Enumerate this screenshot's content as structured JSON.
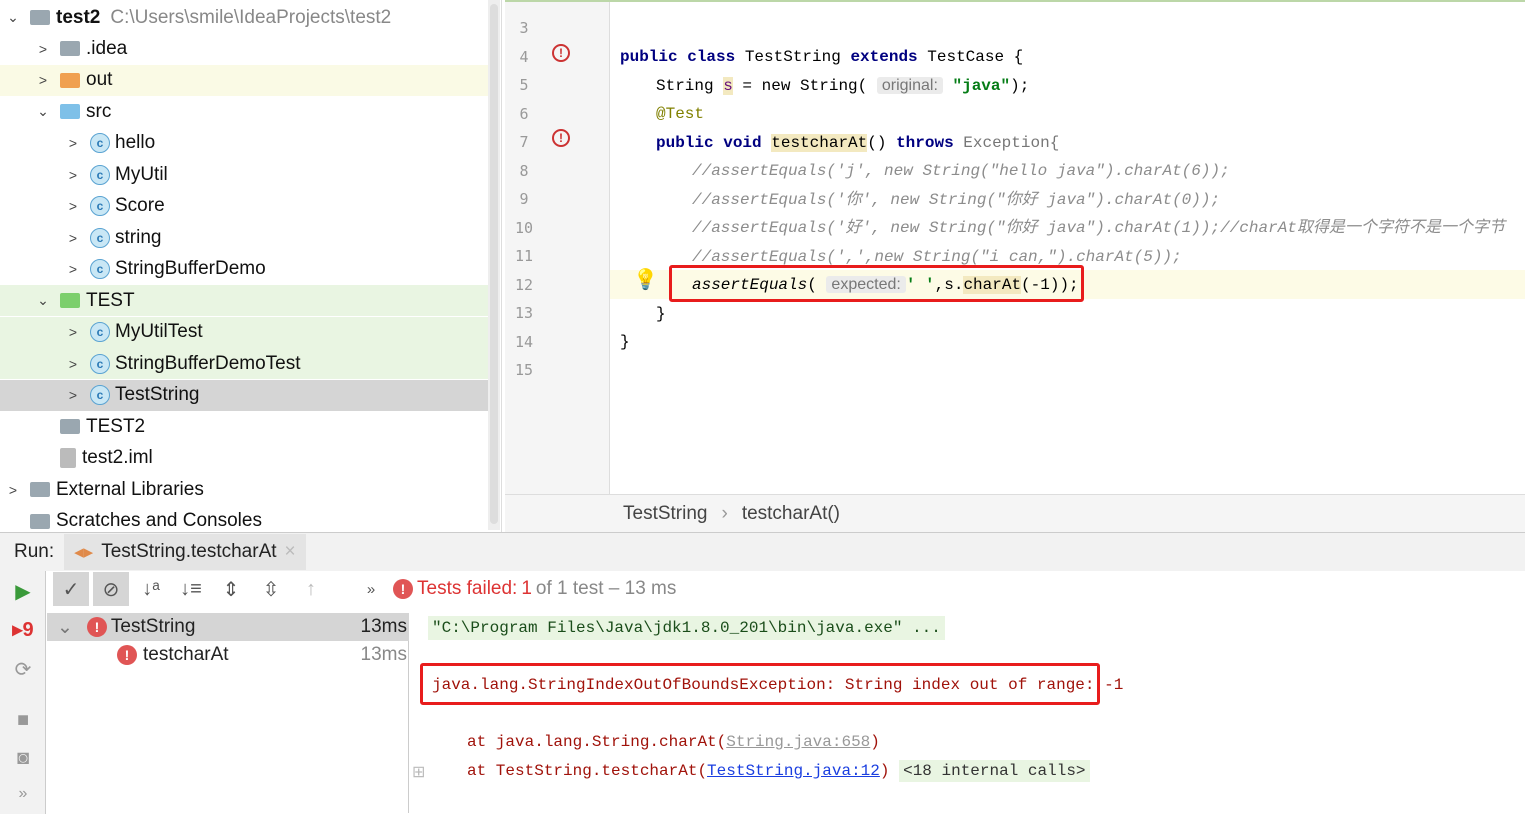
{
  "project": {
    "root": {
      "name": "test2",
      "path": "C:\\Users\\smile\\IdeaProjects\\test2"
    },
    "items": [
      {
        "label": ".idea",
        "type": "folder"
      },
      {
        "label": "out",
        "type": "folder-orange"
      },
      {
        "label": "src",
        "type": "folder-src"
      },
      {
        "label": "hello",
        "type": "class"
      },
      {
        "label": "MyUtil",
        "type": "class"
      },
      {
        "label": "Score",
        "type": "class"
      },
      {
        "label": "string",
        "type": "class"
      },
      {
        "label": "StringBufferDemo",
        "type": "class"
      },
      {
        "label": "TEST",
        "type": "folder-test"
      },
      {
        "label": "MyUtilTest",
        "type": "test-class"
      },
      {
        "label": "StringBufferDemoTest",
        "type": "test-class"
      },
      {
        "label": "TestString",
        "type": "test-class"
      },
      {
        "label": "TEST2",
        "type": "folder"
      },
      {
        "label": "test2.iml",
        "type": "file"
      },
      {
        "label": "External Libraries",
        "type": "library"
      },
      {
        "label": "Scratches and Consoles",
        "type": "scratches"
      }
    ]
  },
  "editor": {
    "line_numbers": [
      "3",
      "4",
      "5",
      "6",
      "7",
      "8",
      "9",
      "10",
      "11",
      "12",
      "13",
      "14",
      "15"
    ],
    "lines": {
      "l4": {
        "kw1": "public class",
        "t1": " TestString ",
        "kw2": "extends",
        "t2": " TestCase {"
      },
      "l5": {
        "t1": "String ",
        "var": "s",
        "t2": " = new String( ",
        "hint": "original:",
        "str": "\"java\"",
        "t3": ");"
      },
      "l6": "@Test",
      "l7": {
        "kw1": "public void",
        "name": "testcharAt",
        "t1": "() ",
        "kw2": "throws",
        "t2": " Exception{"
      },
      "l8": "//assertEquals('j', new String(\"hello java\").charAt(6));",
      "l9": "//assertEquals('你', new String(\"你好 java\").charAt(0));",
      "l10": "//assertEquals('好', new String(\"你好 java\").charAt(1));//charAt取得是一个字符不是一个字节",
      "l11": "//assertEquals(',',new String(\"i can,\").charAt(5));",
      "l12": {
        "call": "assertEquals",
        "t1": "( ",
        "hint": "expected:",
        "str": "' '",
        "t2": ",s.",
        "m": "charAt",
        "t3": "(-1));"
      },
      "l13": "}",
      "l14": "}"
    }
  },
  "breadcrumb": [
    "TestString",
    "testcharAt()"
  ],
  "run": {
    "label": "Run:",
    "tab": "TestString.testcharAt",
    "status": {
      "prefix": "Tests failed:",
      "failed": "1",
      "rest": "of 1 test – 13 ms"
    },
    "tree": [
      {
        "label": "TestString",
        "time": "13ms"
      },
      {
        "label": "testcharAt",
        "time": "13ms"
      }
    ],
    "console": {
      "cmd": "\"C:\\Program Files\\Java\\jdk1.8.0_201\\bin\\java.exe\" ...",
      "exception": "java.lang.StringIndexOutOfBoundsException: String index out of range: -1",
      "trace": [
        {
          "prefix": "at java.lang.String.charAt(",
          "link": "String.java:658",
          "suffix": ")"
        },
        {
          "prefix": "at TestString.testcharAt(",
          "link": "TestString.java:12",
          "suffix": ")",
          "extra": "<18 internal calls>"
        }
      ]
    }
  }
}
